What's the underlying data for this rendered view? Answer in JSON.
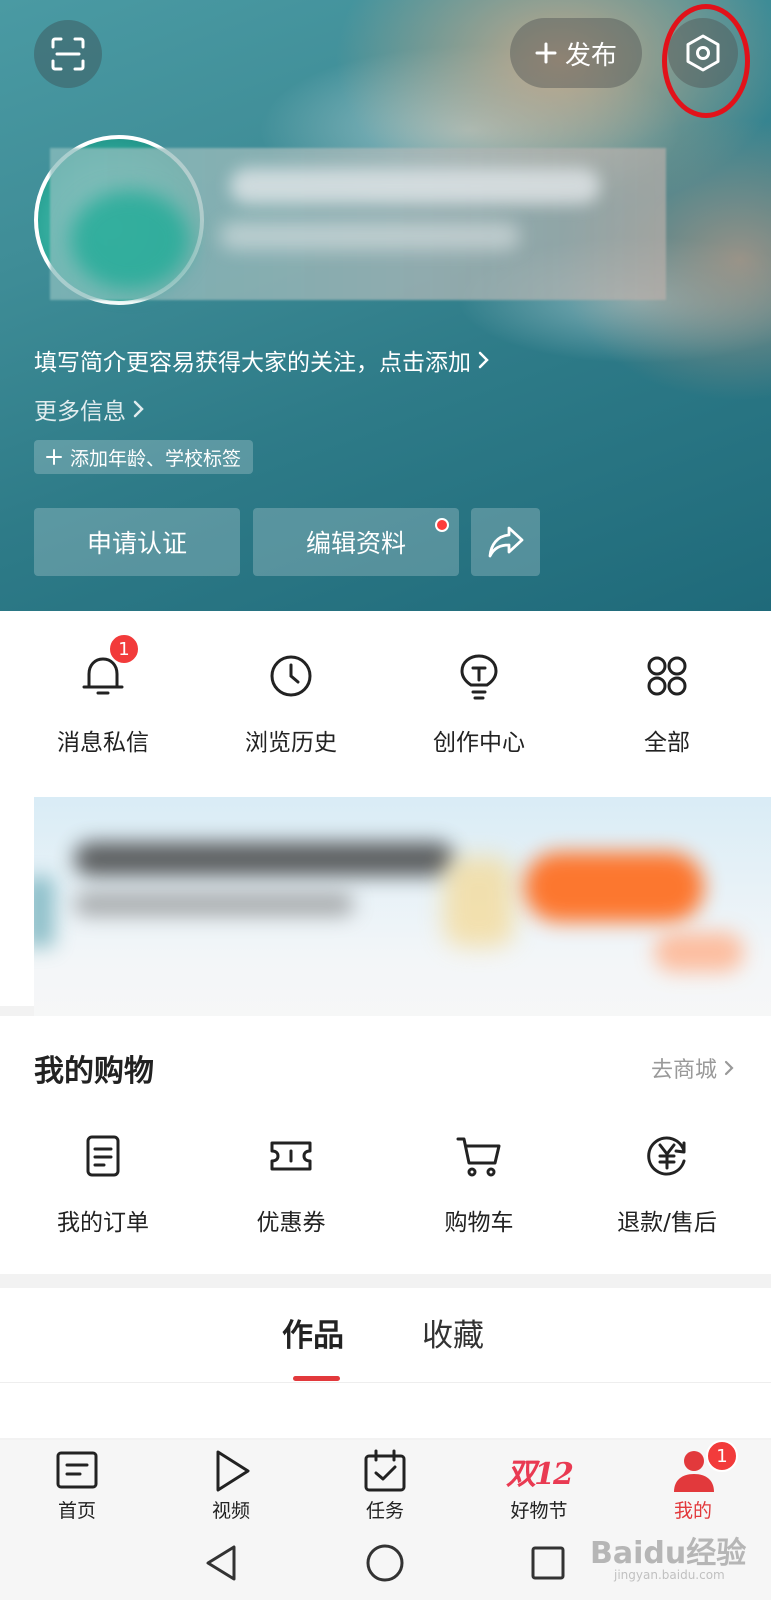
{
  "header": {
    "publish_label": "发布",
    "bio_prompt": "填写简介更容易获得大家的关注，点击添加",
    "more_info": "更多信息",
    "tag_prompt": "添加年龄、学校标签",
    "buttons": {
      "certify": "申请认证",
      "edit_profile": "编辑资料"
    }
  },
  "quick_actions": [
    {
      "label": "消息私信",
      "icon": "bell-icon",
      "badge": "1"
    },
    {
      "label": "浏览历史",
      "icon": "clock-icon"
    },
    {
      "label": "创作中心",
      "icon": "lightbulb-icon"
    },
    {
      "label": "全部",
      "icon": "grid-icon"
    }
  ],
  "shopping": {
    "title": "我的购物",
    "store_link": "去商城",
    "items": [
      {
        "label": "我的订单",
        "icon": "order-icon"
      },
      {
        "label": "优惠券",
        "icon": "coupon-icon"
      },
      {
        "label": "购物车",
        "icon": "cart-icon"
      },
      {
        "label": "退款/售后",
        "icon": "refund-icon"
      }
    ]
  },
  "tabs": [
    {
      "label": "作品",
      "active": true
    },
    {
      "label": "收藏",
      "active": false
    }
  ],
  "bottom_nav": [
    {
      "label": "首页",
      "icon": "home-icon"
    },
    {
      "label": "视频",
      "icon": "play-icon"
    },
    {
      "label": "任务",
      "icon": "calendar-check-icon"
    },
    {
      "label": "好物节",
      "icon": "double-twelve-logo",
      "logo_text": "双12"
    },
    {
      "label": "我的",
      "icon": "user-icon",
      "active": true,
      "badge": "1"
    }
  ],
  "watermark": {
    "main": "Baidu经验",
    "sub": "jingyan.baidu.com"
  },
  "colors": {
    "accent": "#e2393c",
    "badge": "#f23b3b",
    "highlight_ring": "#e2121a"
  }
}
